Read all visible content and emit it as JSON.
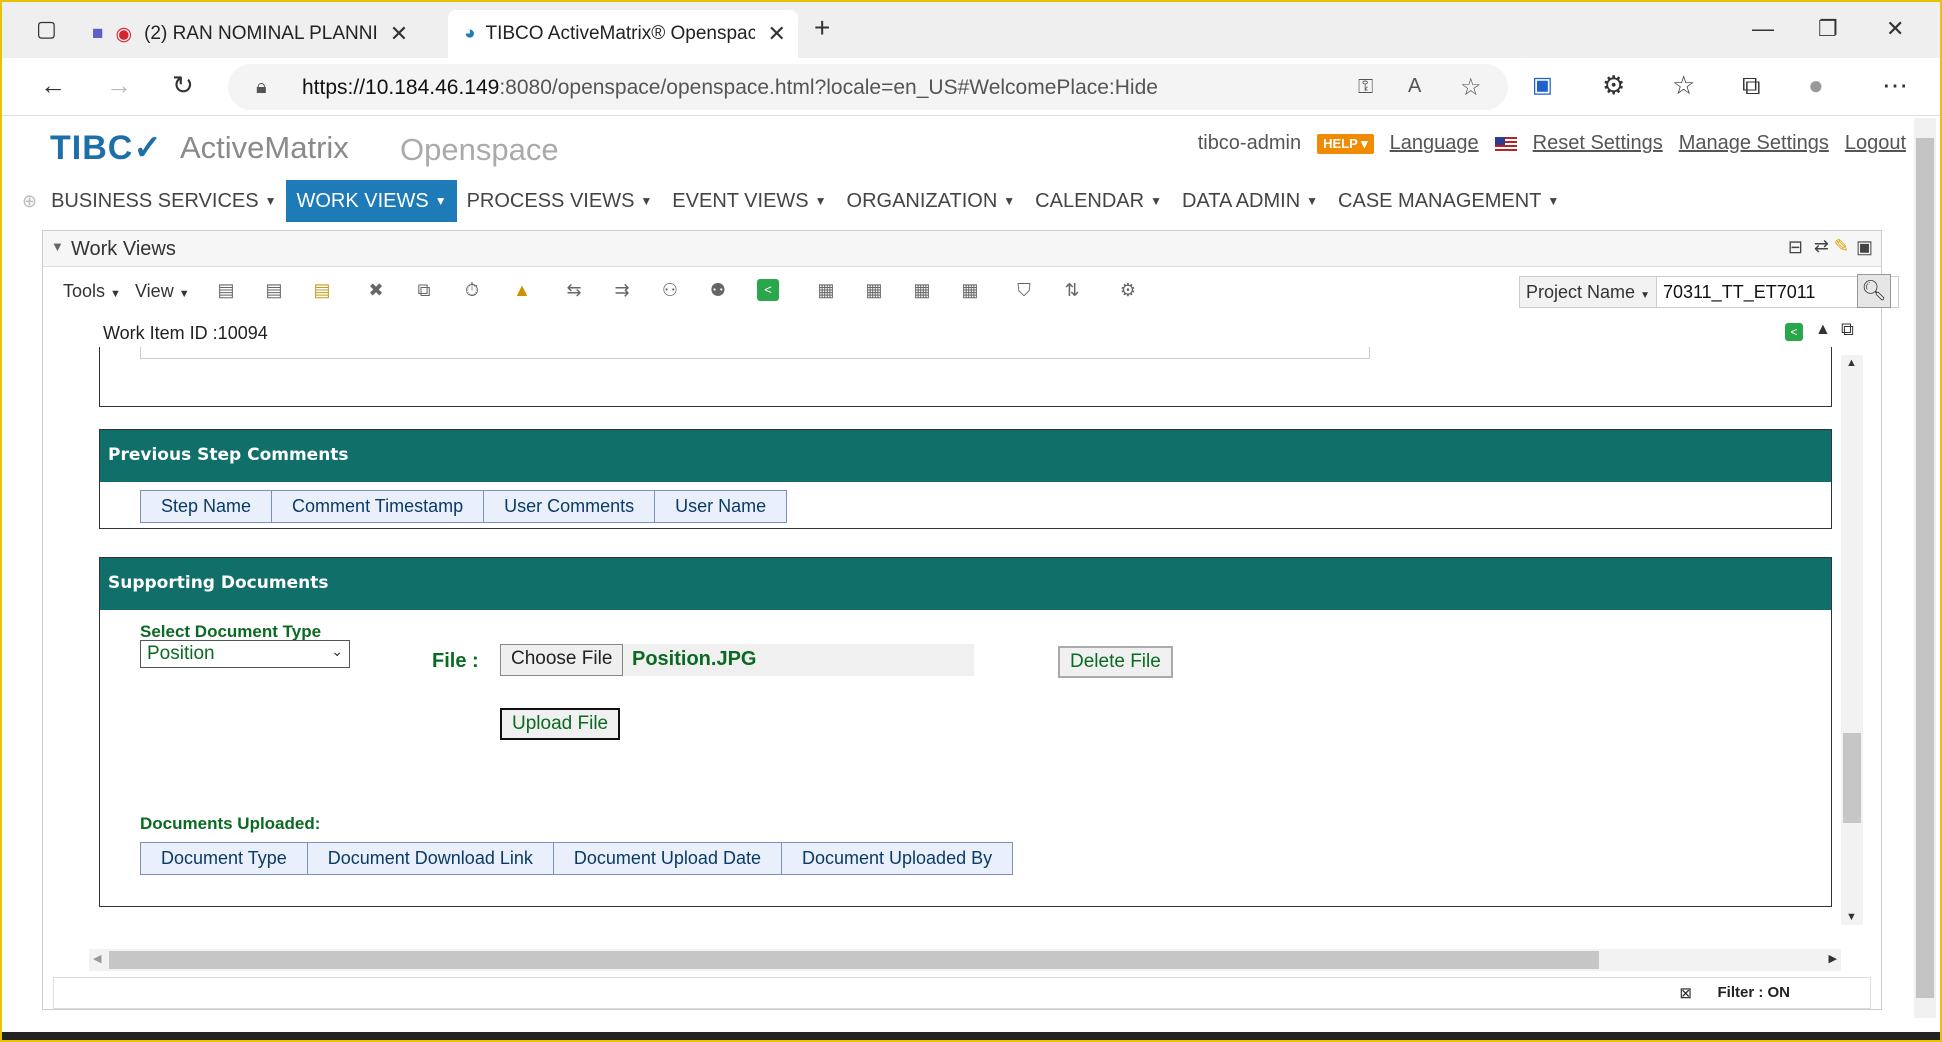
{
  "browser": {
    "tabs": [
      {
        "title": "(2) RAN NOMINAL PLANNI"
      },
      {
        "title": "TIBCO ActiveMatrix® Openspace"
      }
    ],
    "url_host": "https://10.184.46.149",
    "url_rest": ":8080/openspace/openspace.html?locale=en_US#WelcomePlace:Hide"
  },
  "app": {
    "logo": "TIBC✓",
    "product": "ActiveMatrix",
    "product2": "Openspace",
    "user": "tibco-admin",
    "help": "HELP ▾",
    "links": {
      "language": "Language",
      "reset": "Reset Settings",
      "manage": "Manage Settings",
      "logout": "Logout"
    }
  },
  "menu": [
    {
      "label": "BUSINESS SERVICES"
    },
    {
      "label": "WORK VIEWS"
    },
    {
      "label": "PROCESS VIEWS"
    },
    {
      "label": "EVENT VIEWS"
    },
    {
      "label": "ORGANIZATION"
    },
    {
      "label": "CALENDAR"
    },
    {
      "label": "DATA ADMIN"
    },
    {
      "label": "CASE MANAGEMENT"
    }
  ],
  "panel": {
    "title": "Work Views",
    "tools": "Tools",
    "view": "View",
    "project_label": "Project Name",
    "project_value": "70311_TT_ET7011",
    "work_item": "Work Item ID :10094"
  },
  "prev_comments": {
    "title": "Previous Step Comments",
    "columns": [
      "Step Name",
      "Comment Timestamp",
      "User Comments",
      "User Name"
    ]
  },
  "supporting": {
    "title": "Supporting Documents",
    "select_label": "Select Document Type",
    "select_value": "Position",
    "file_label": "File :",
    "choose_file": "Choose File",
    "file_name": "Position.JPG",
    "delete_file": "Delete File",
    "upload_file": "Upload File",
    "uploaded_label": "Documents Uploaded:",
    "columns": [
      "Document Type",
      "Document Download Link",
      "Document Upload Date",
      "Document Uploaded By"
    ]
  },
  "status": {
    "filter": "Filter : ON"
  },
  "colors": {
    "accent": "#1f7ab8",
    "section_header": "#107069",
    "label_green": "#0b6a22"
  }
}
